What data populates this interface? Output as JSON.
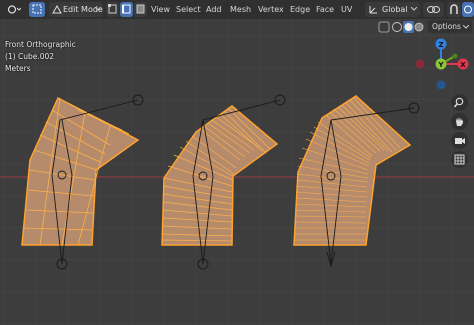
{
  "header": {
    "mode_label": "Edit Mode",
    "menus": [
      "View",
      "Select",
      "Add",
      "Mesh",
      "Vertex",
      "Edge",
      "Face",
      "UV"
    ],
    "transform_orientation": "Global",
    "icons": [
      "editor-type-icon",
      "select-box-icon",
      "vertex-select-icon",
      "edge-select-icon",
      "face-select-icon",
      "transform-pivot-icon",
      "link-icon",
      "snap-icon",
      "proportional-edit-icon",
      "overlay-icon",
      "xray-icon",
      "shading-solid-icon"
    ]
  },
  "viewport": {
    "view_name": "Front Orthographic",
    "object_name": "(1) Cube.002",
    "units": "Meters",
    "options_label": "Options"
  },
  "gizmo": {
    "z_label": "Z",
    "x_label": "X",
    "y_label": "Y",
    "colors": {
      "x": "#e0364f",
      "y": "#6ea51f",
      "z": "#2f83e3",
      "y_neg": "#8cc53a"
    }
  },
  "navigation": {
    "buttons": [
      "zoom-icon",
      "pan-hand-icon",
      "camera-icon",
      "grid-icon"
    ]
  },
  "colors": {
    "background": "#3d3d3d",
    "grid_line": "#484848",
    "x_axis": "#9b3a45",
    "mesh_fill": "#b58b6b",
    "mesh_edge": "#ffa22e",
    "active_button": "#4772b3"
  }
}
